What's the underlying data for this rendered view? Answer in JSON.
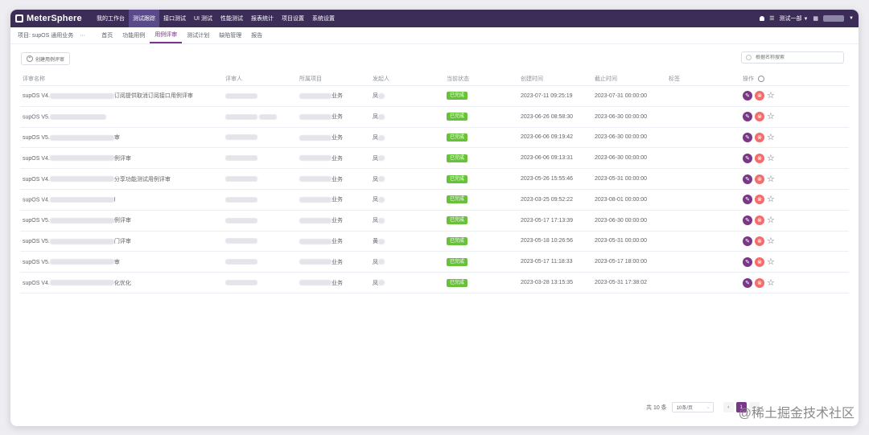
{
  "brand": {
    "name": "MeterSphere"
  },
  "top_nav": [
    "我的工作台",
    "测试跟踪",
    "接口测试",
    "UI 测试",
    "性能测试",
    "报表统计",
    "项目设置",
    "系统设置"
  ],
  "top_nav_active": 1,
  "top_right": {
    "workspace": "测试一部",
    "lang_icon": "grid"
  },
  "subnav": {
    "project_label": "项目: supOS 通用业务",
    "tabs": [
      "首页",
      "功能用例",
      "用例评审",
      "测试计划",
      "缺陷管理",
      "报告"
    ],
    "active": 2
  },
  "toolbar": {
    "create_label": "创建用例评审",
    "search_placeholder": "根据名称搜索"
  },
  "columns": [
    "评审名称",
    "评审人",
    "所属项目",
    "发起人",
    "当前状态",
    "创建时间",
    "截止时间",
    "标签",
    "操作"
  ],
  "rows": [
    {
      "name_prefix": "supOS V4.",
      "name_suffix": "订阅提供取消订阅接口用例评审",
      "project_suffix": "业务",
      "creator_prefix": "凤",
      "status": "已完成",
      "created": "2023-07-11 09:25:19",
      "end": "2023-07-31 00:00:00"
    },
    {
      "name_prefix": "supOS V5.",
      "name_suffix": "",
      "project_suffix": "业务",
      "creator_prefix": "凤",
      "status": "已完成",
      "created": "2023-06-26 08:58:30",
      "end": "2023-06-30 00:00:00"
    },
    {
      "name_prefix": "supOS V5.",
      "name_suffix": "审",
      "project_suffix": "业务",
      "creator_prefix": "凤",
      "status": "已完成",
      "created": "2023-06-06 09:19:42",
      "end": "2023-06-30 00:00:00"
    },
    {
      "name_prefix": "supOS V4.",
      "name_suffix": "例评审",
      "project_suffix": "业务",
      "creator_prefix": "凤",
      "status": "已完成",
      "created": "2023-06-06 09:13:31",
      "end": "2023-06-30 00:00:00"
    },
    {
      "name_prefix": "supOS V4.",
      "name_suffix": "分享功能测试用例评审",
      "project_suffix": "业务",
      "creator_prefix": "凤",
      "status": "已完成",
      "created": "2023-05-26 15:55:46",
      "end": "2023-05-31 00:00:00"
    },
    {
      "name_prefix": "supOS V4.",
      "name_suffix": "l",
      "project_suffix": "业务",
      "creator_prefix": "凤",
      "status": "已完成",
      "created": "2023-03-25 09:52:22",
      "end": "2023-08-01 00:00:00"
    },
    {
      "name_prefix": "supOS V5.",
      "name_suffix": "例评审",
      "project_suffix": "业务",
      "creator_prefix": "凤",
      "status": "已完成",
      "created": "2023-05-17 17:13:39",
      "end": "2023-06-30 00:00:00"
    },
    {
      "name_prefix": "supOS V5.",
      "name_suffix": "门评审",
      "project_suffix": "业务",
      "creator_prefix": "黄",
      "status": "已完成",
      "created": "2023-05-18 10:26:56",
      "end": "2023-05-31 00:00:00"
    },
    {
      "name_prefix": "supOS V5.",
      "name_suffix": "审",
      "project_suffix": "业务",
      "creator_prefix": "凤",
      "status": "已完成",
      "created": "2023-05-17 11:18:33",
      "end": "2023-05-17 18:00:00"
    },
    {
      "name_prefix": "supOS V4.",
      "name_suffix": "化优化",
      "project_suffix": "业务",
      "creator_prefix": "凤",
      "status": "已完成",
      "created": "2023-03-28 13:15:35",
      "end": "2023-05-31 17:38:02"
    }
  ],
  "ops": {
    "edit_glyph": "✎",
    "delete_glyph": "⊗",
    "star_glyph": "☆"
  },
  "pagination": {
    "total": "共 10 条",
    "page_size": "10条/页",
    "current": "1"
  },
  "watermark": "@稀土掘金技术社区",
  "colors": {
    "brand": "#3b2d57",
    "accent": "#783887",
    "success": "#67c23a",
    "danger": "#f56c6c"
  }
}
